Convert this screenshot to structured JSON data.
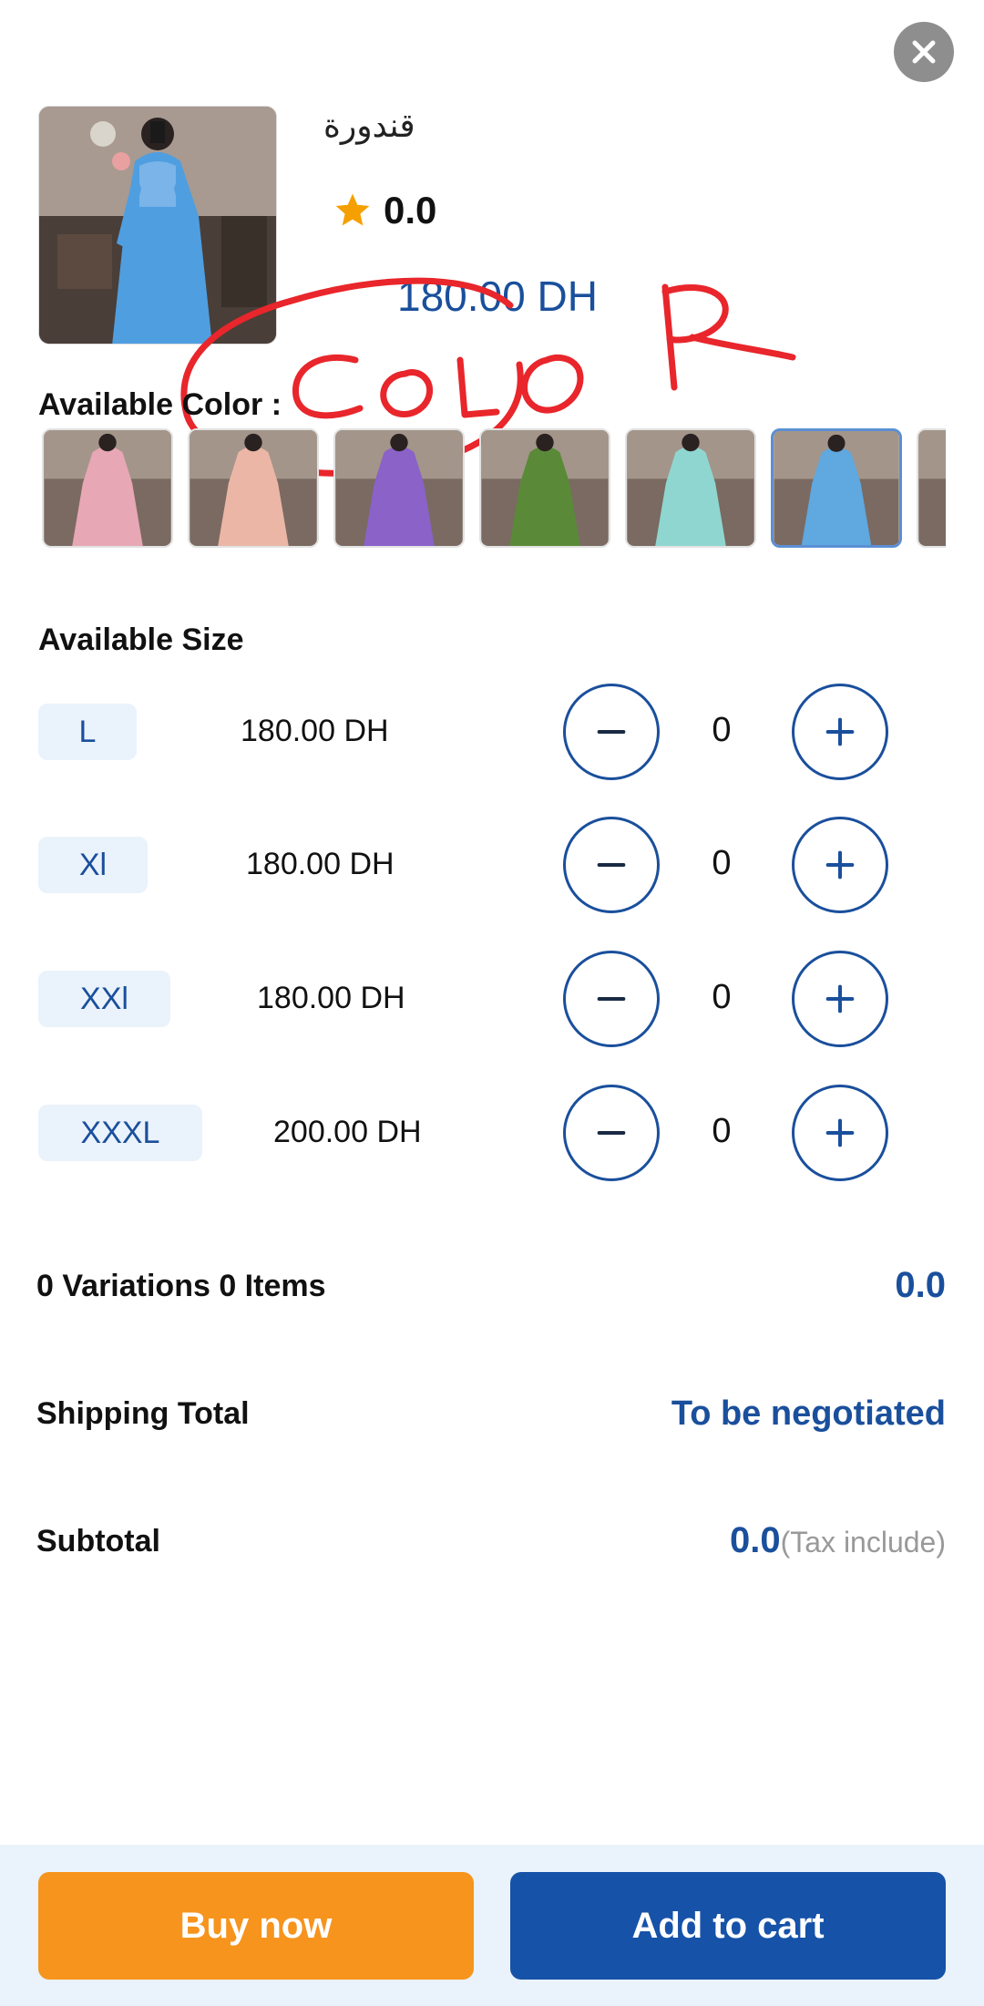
{
  "close": {
    "icon": "close-icon"
  },
  "product": {
    "name": "قندورة",
    "rating": "0.0",
    "price": "180.00 DH"
  },
  "colors": {
    "label": "Available Color :",
    "swatches": [
      {
        "name": "pink",
        "hex": "#e7a7b4"
      },
      {
        "name": "peach",
        "hex": "#ebb6a6"
      },
      {
        "name": "purple",
        "hex": "#8a62c8"
      },
      {
        "name": "green",
        "hex": "#5a8a38"
      },
      {
        "name": "mint",
        "hex": "#8fd6d0"
      },
      {
        "name": "blue",
        "hex": "#5fa8e0",
        "selected": true
      },
      {
        "name": "more",
        "hex": "#9b7e6e"
      }
    ]
  },
  "sizes": {
    "label": "Available  Size",
    "items": [
      {
        "size": "L",
        "price": "180.00 DH",
        "qty": "0"
      },
      {
        "size": "Xl",
        "price": "180.00 DH",
        "qty": "0"
      },
      {
        "size": "XXl",
        "price": "180.00 DH",
        "qty": "0"
      },
      {
        "size": "XXXL",
        "price": "200.00 DH",
        "qty": "0"
      }
    ]
  },
  "summary": {
    "variations_label": "0 Variations 0 Items",
    "variations_value": "0.0",
    "shipping_label": "Shipping Total",
    "shipping_value": "To be negotiated",
    "subtotal_label": "Subtotal",
    "subtotal_value": "0.0",
    "subtotal_note": "(Tax include)"
  },
  "actions": {
    "buy_now": "Buy now",
    "add_to_cart": "Add to cart"
  },
  "annotation": {
    "text": "COLOR",
    "color": "#e8262b"
  },
  "theme": {
    "accent": "#1a4f9c",
    "orange": "#f7941d",
    "star": "#f5a000"
  }
}
